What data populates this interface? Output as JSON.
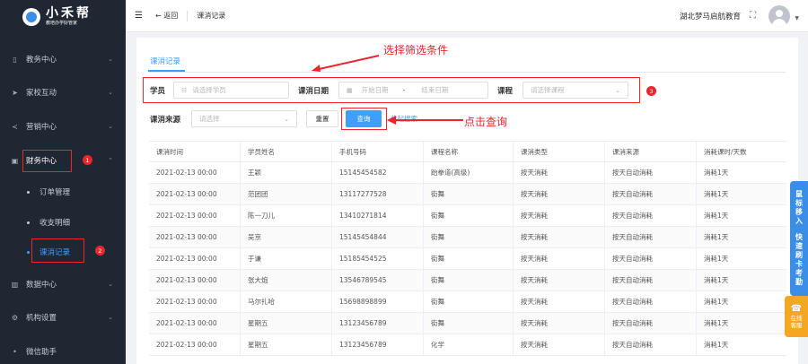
{
  "logo": {
    "title": "小禾帮",
    "subtitle": "教培办学好管家"
  },
  "sidebar": {
    "items": [
      {
        "label": "教务中心",
        "icon": "book-icon"
      },
      {
        "label": "家校互动",
        "icon": "send-icon"
      },
      {
        "label": "营销中心",
        "icon": "share-icon"
      },
      {
        "label": "财务中心",
        "icon": "finance-icon"
      },
      {
        "label": "数据中心",
        "icon": "chart-icon"
      },
      {
        "label": "机构设置",
        "icon": "gear-icon"
      },
      {
        "label": "微信助手",
        "icon": "dot-icon"
      }
    ],
    "subitems": [
      "订单管理",
      "收支明细",
      "课消记录"
    ],
    "badges": [
      "1",
      "2"
    ]
  },
  "header": {
    "back_label": "← 返回",
    "title": "课消记录",
    "org": "湖北梦马启航教育"
  },
  "tab": "课消记录",
  "filters": {
    "student_label": "学员",
    "student_placeholder": "请选择学员",
    "date_label": "课消日期",
    "start_placeholder": "开始日期",
    "date_sep": "-",
    "end_placeholder": "结束日期",
    "course_label": "课程",
    "course_placeholder": "请选择课程",
    "badge": "3",
    "source_label": "课消来源",
    "source_placeholder": "请选择",
    "reset_label": "重置",
    "query_label": "查询",
    "collapse_label": "收起搜索"
  },
  "annotations": {
    "filter_hint": "选择筛选条件",
    "query_hint": "点击查询"
  },
  "table": {
    "columns": [
      "课消时间",
      "学员姓名",
      "手机号码",
      "课程名称",
      "课消类型",
      "课消来源",
      "消耗课时/天数"
    ],
    "rows": [
      [
        "2021-02-13 00:00",
        "王颖",
        "15145454582",
        "跆拳道(高级)",
        "按天消耗",
        "按天自动消耗",
        "消耗1天"
      ],
      [
        "2021-02-13 00:00",
        "范团团",
        "13117277528",
        "街舞",
        "按天消耗",
        "按天自动消耗",
        "消耗1天"
      ],
      [
        "2021-02-13 00:00",
        "陈一刀儿",
        "13410271814",
        "街舞",
        "按天消耗",
        "按天自动消耗",
        "消耗1天"
      ],
      [
        "2021-02-13 00:00",
        "吴京",
        "15145454844",
        "街舞",
        "按天消耗",
        "按天自动消耗",
        "消耗1天"
      ],
      [
        "2021-02-13 00:00",
        "于谦",
        "15185454525",
        "街舞",
        "按天消耗",
        "按天自动消耗",
        "消耗1天"
      ],
      [
        "2021-02-13 00:00",
        "张大炮",
        "13546789545",
        "街舞",
        "按天消耗",
        "按天自动消耗",
        "消耗1天"
      ],
      [
        "2021-02-13 00:00",
        "马尔扎哈",
        "15698898899",
        "街舞",
        "按天消耗",
        "按天自动消耗",
        "消耗1天"
      ],
      [
        "2021-02-13 00:00",
        "星期五",
        "13123456789",
        "街舞",
        "按天消耗",
        "按天自动消耗",
        "消耗1天"
      ],
      [
        "2021-02-13 00:00",
        "星期五",
        "13123456789",
        "化学",
        "按天消耗",
        "按天自动消耗",
        "消耗1天"
      ]
    ]
  },
  "float": {
    "group1": "鼠标移入",
    "group2": "快速刷卡考勤",
    "service": "在线客服"
  },
  "colors": {
    "accent": "#409eff",
    "sidebar_bg": "#1f2733",
    "annotation": "#e8262c"
  }
}
